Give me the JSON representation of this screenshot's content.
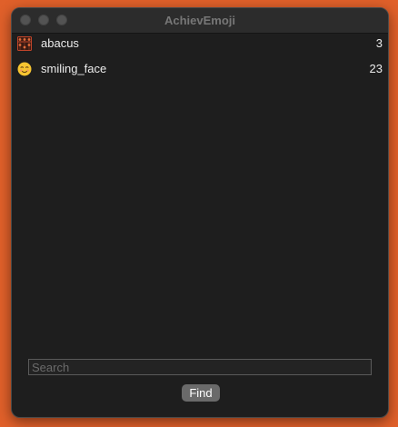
{
  "window": {
    "title": "AchievEmoji"
  },
  "items": [
    {
      "icon": "abacus-icon",
      "label": "abacus",
      "count": "3"
    },
    {
      "icon": "smiling-face-icon",
      "label": "smiling_face",
      "count": "23"
    }
  ],
  "search": {
    "placeholder": "Search",
    "value": ""
  },
  "find_button": {
    "label": "Find"
  },
  "colors": {
    "desktop": "#e0602a",
    "window_bg": "#1e1e1e",
    "button_bg": "#6a6a6a"
  }
}
